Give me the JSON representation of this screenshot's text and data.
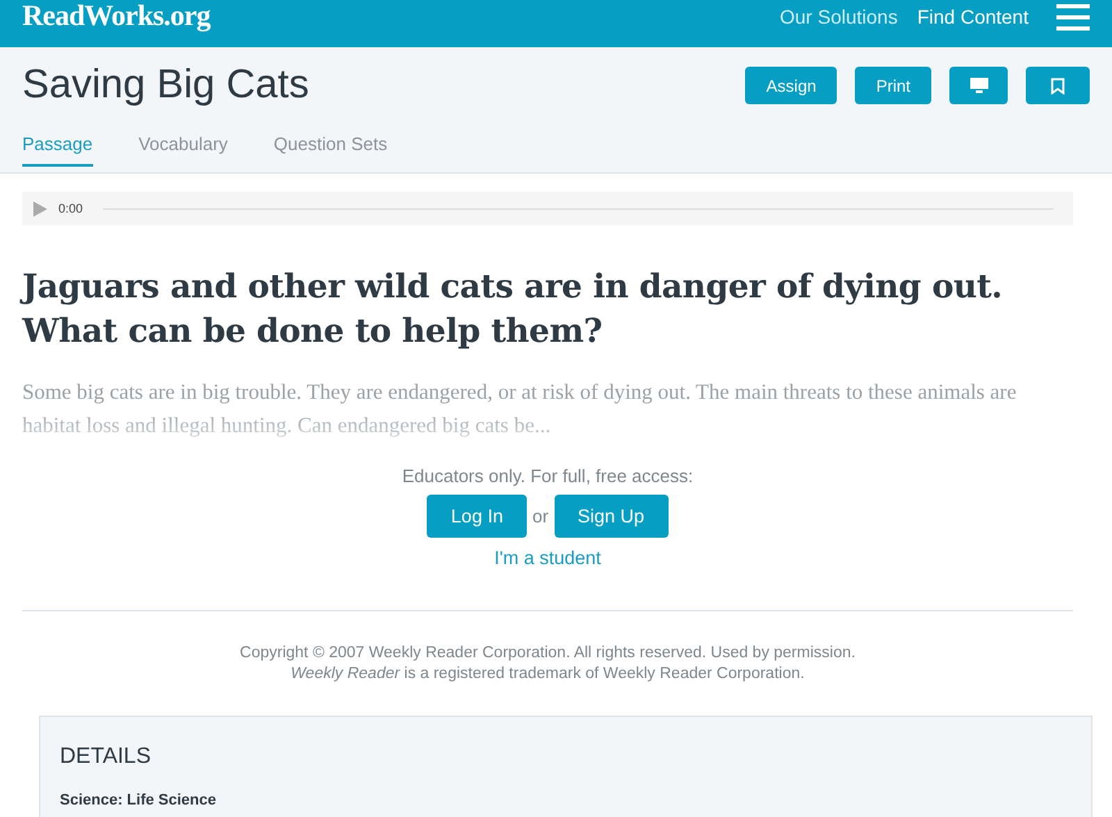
{
  "header": {
    "logo": "ReadWorks.org",
    "nav": [
      "Our Solutions",
      "Find Content"
    ]
  },
  "page": {
    "title": "Saving Big Cats",
    "actions": [
      {
        "kind": "text",
        "label": "Assign"
      },
      {
        "kind": "text",
        "label": "Print"
      },
      {
        "kind": "monitor"
      },
      {
        "kind": "bookmark"
      }
    ]
  },
  "tabs": [
    {
      "label": "Passage",
      "selected": true
    },
    {
      "label": "Vocabulary",
      "selected": false
    },
    {
      "label": "Question Sets",
      "selected": false
    }
  ],
  "audio": {
    "time": "0:00"
  },
  "headline": "Jaguars and other wild cats are in danger of dying out. What can be done to help them?",
  "excerpt": "Some big cats are in big trouble. They are endangered, or at risk of dying out. The main threats to these animals are habitat loss and illegal hunting. Can endangered big cats be...",
  "access": {
    "prompt": "Educators only. For full, free access:",
    "login": "Log In",
    "or": "or",
    "signup": "Sign Up",
    "student": "I'm a student"
  },
  "copyright": [
    "Copyright © 2007 Weekly Reader Corporation. All rights reserved. Used by permission.",
    "*Weekly Reader* is a registered trademark of Weekly Reader Corporation."
  ],
  "details": {
    "heading": "DETAILS",
    "subject": "Science: Life Science"
  }
}
